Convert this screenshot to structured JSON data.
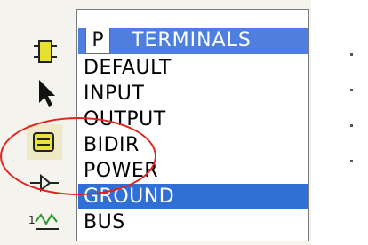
{
  "panel": {
    "mode_button": "P",
    "title": "TERMINALS",
    "items": [
      {
        "label": "DEFAULT",
        "selected": false
      },
      {
        "label": "INPUT",
        "selected": false
      },
      {
        "label": "OUTPUT",
        "selected": false
      },
      {
        "label": "BIDIR",
        "selected": false
      },
      {
        "label": "POWER",
        "selected": false
      },
      {
        "label": "GROUND",
        "selected": true
      },
      {
        "label": "BUS",
        "selected": false
      }
    ]
  },
  "toolbar": {
    "tools": [
      "component-icon",
      "pointer-arrow-icon",
      "terminal-mode-icon",
      "pin-icon",
      "graph-icon"
    ]
  },
  "colors": {
    "header": "#4f7fde",
    "selection": "#2f6fd6",
    "highlight_circle": "#e0231d"
  }
}
